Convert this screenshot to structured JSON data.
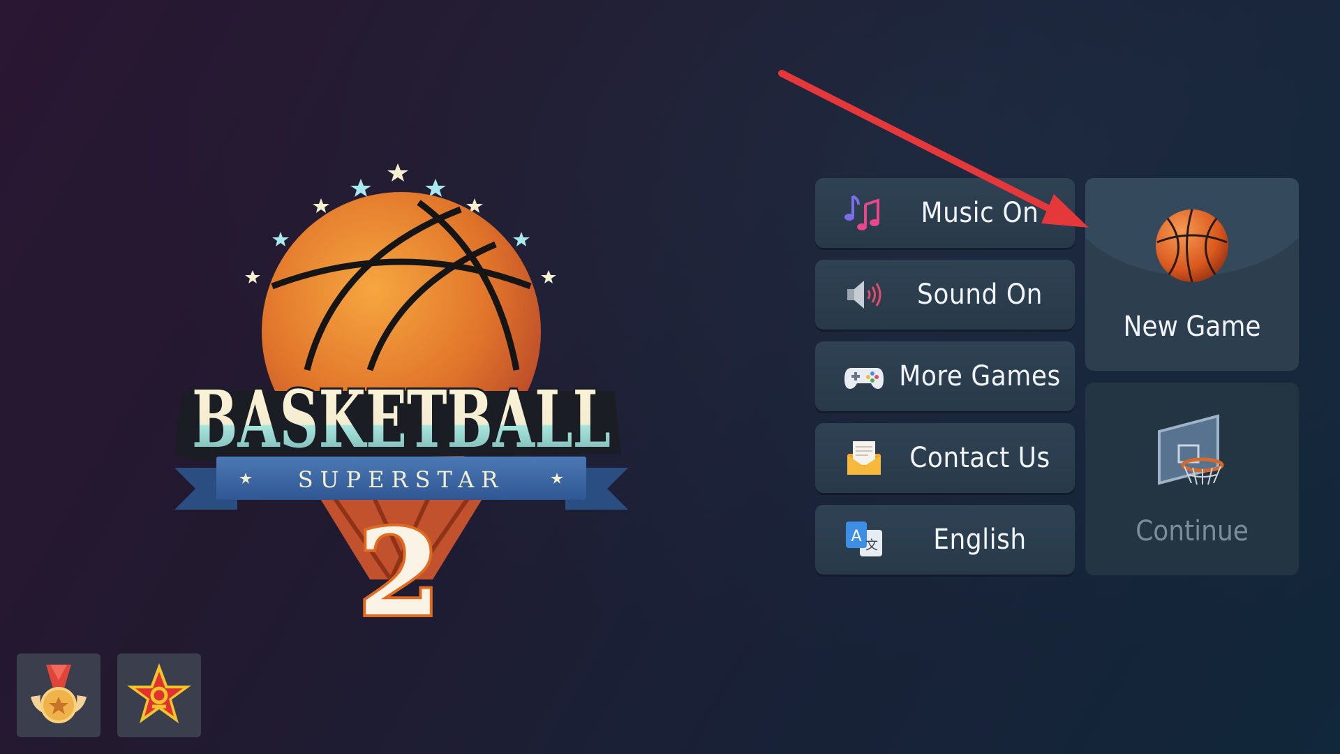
{
  "logo": {
    "word": "BASKETBALL",
    "subtitle": "SUPERSTAR",
    "number": "2"
  },
  "menu": [
    {
      "label": "Music On",
      "icon": "music-notes-icon"
    },
    {
      "label": "Sound On",
      "icon": "speaker-icon"
    },
    {
      "label": "More Games",
      "icon": "gamepad-icon"
    },
    {
      "label": "Contact Us",
      "icon": "mail-icon"
    },
    {
      "label": "English",
      "icon": "translate-icon"
    }
  ],
  "tiles": {
    "new_game": {
      "label": "New Game",
      "icon": "basketball-icon"
    },
    "continue": {
      "label": "Continue",
      "icon": "hoop-icon"
    }
  },
  "badges": [
    {
      "icon": "medal-icon"
    },
    {
      "icon": "star-badge-icon"
    }
  ],
  "colors": {
    "button_bg": "#2f4253",
    "tile_new_bg": "#2d3e4f",
    "tile_continue_bg": "#233443",
    "arrow": "#e5383b",
    "ball_orange": "#e8772a"
  }
}
